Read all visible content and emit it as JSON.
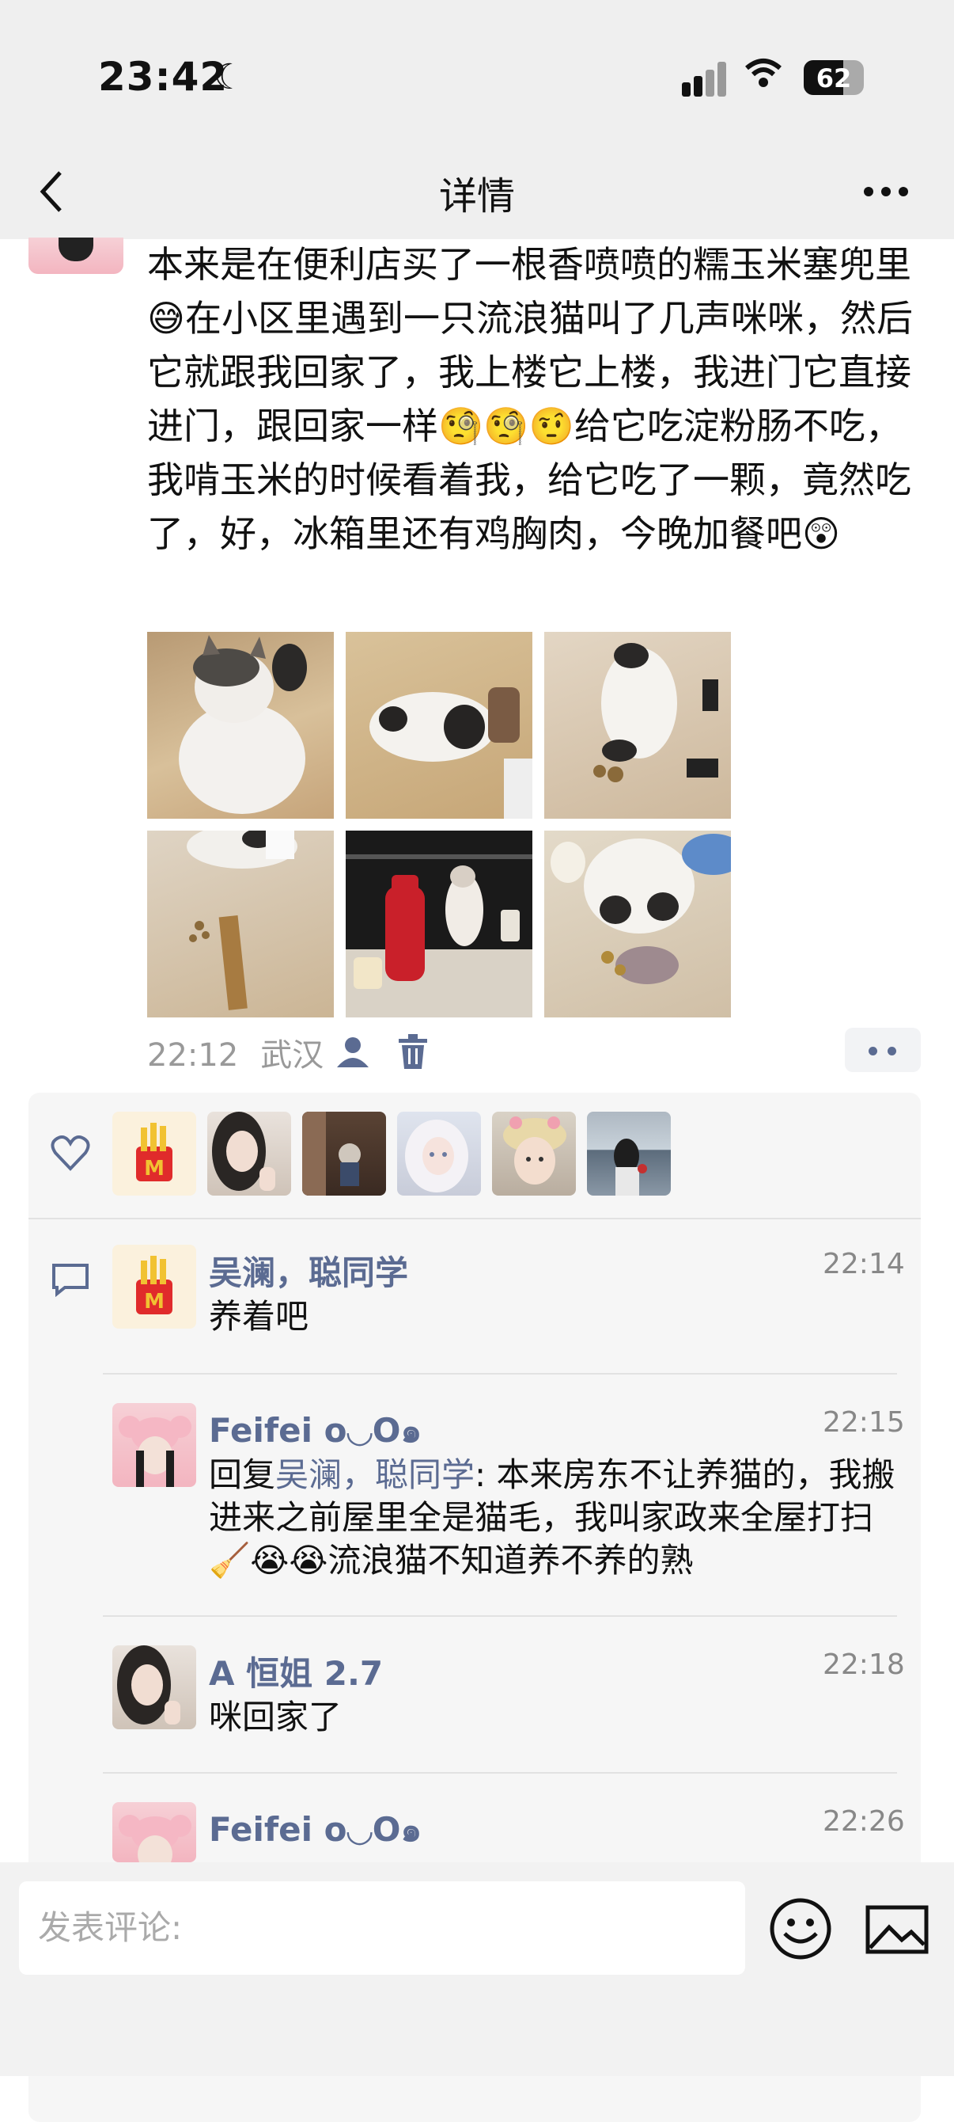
{
  "status": {
    "time": "23:42",
    "battery": "62"
  },
  "nav": {
    "title": "详情"
  },
  "post": {
    "text": "本来是在便利店买了一根香喷喷的糯玉米塞兜里😅在小区里遇到一只流浪猫叫了几声咪咪，然后它就跟我回家了，我上楼它上楼，我进门它直接进门，跟回家一样🧐🧐🤨给它吃淀粉肠不吃，我啃玉米的时候看着我，给它吃了一颗，竟然吃了，好，冰箱里还有鸡胸肉，今晚加餐吧😲",
    "time": "22:12",
    "location": "武汉"
  },
  "comments": [
    {
      "name": "吴澜，聪同学",
      "time": "22:14",
      "text": "养着吧"
    },
    {
      "name": "Feifei o◡O๑",
      "time": "22:15",
      "reply_prefix": "回复",
      "reply_to": "吴澜，聪同学",
      "text": ": 本来房东不让养猫的，我搬进来之前屋里全是猫毛，我叫家政来全屋打扫🧹😭😭流浪猫不知道养不养的熟"
    },
    {
      "name": "A 恒姐 2.7",
      "time": "22:18",
      "text": "咪回家了"
    },
    {
      "name": "Feifei o◡O๑",
      "time": "22:26",
      "text": ""
    }
  ],
  "composer": {
    "placeholder": "发表评论:"
  },
  "colors": {
    "link": "#5b6b92",
    "background": "#ffffff",
    "panel": "#f6f6f6"
  },
  "icons": [
    "moon-icon",
    "signal-icon",
    "wifi-icon",
    "battery-icon",
    "back-icon",
    "more-icon",
    "contact-icon",
    "trash-icon",
    "heart-icon",
    "comment-icon",
    "emoji-icon",
    "image-icon"
  ]
}
